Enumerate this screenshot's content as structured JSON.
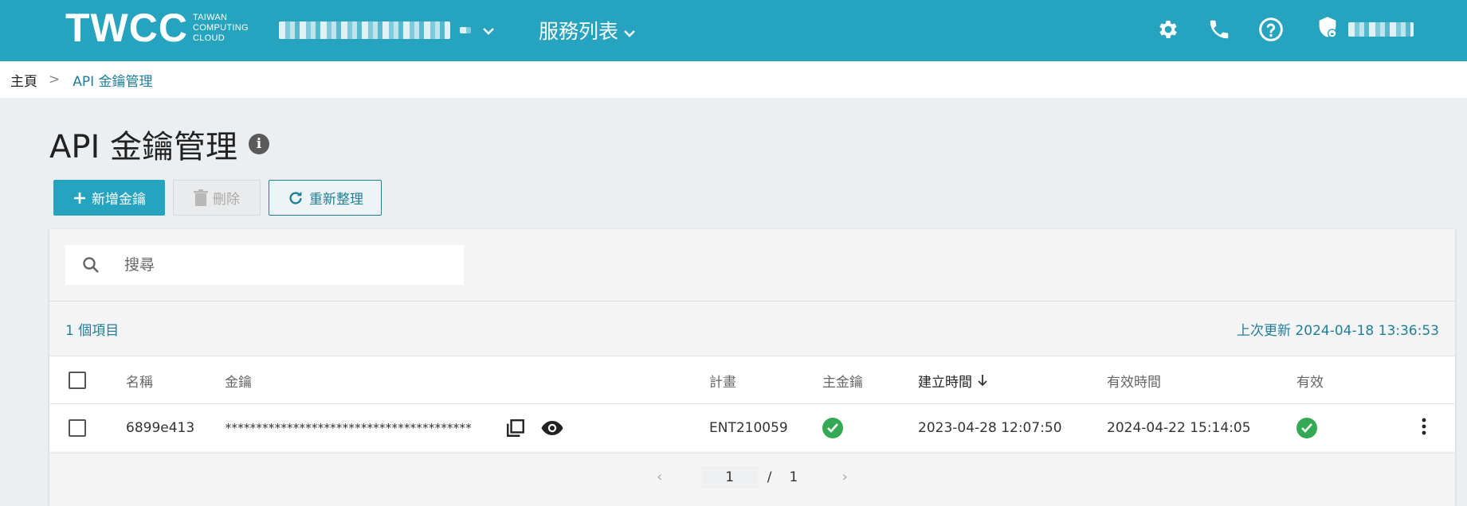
{
  "app": {
    "logo_main": "TWCC",
    "logo_sub": [
      "TAIWAN",
      "COMPUTING",
      "CLOUD"
    ]
  },
  "nav": {
    "services_label": "服務列表",
    "icons": [
      "settings-icon",
      "phone-icon",
      "help-icon",
      "user-shield-icon"
    ]
  },
  "breadcrumb": {
    "home": "主頁",
    "separator": ">",
    "current": "API 金鑰管理"
  },
  "page": {
    "title": "API 金鑰管理"
  },
  "toolbar": {
    "add_label": "新增金鑰",
    "delete_label": "刪除",
    "refresh_label": "重新整理"
  },
  "search": {
    "placeholder": "搜尋"
  },
  "summary": {
    "count_text": "1 個項目",
    "last_updated": "上次更新 2024-04-18 13:36:53"
  },
  "table": {
    "headers": {
      "name": "名稱",
      "key": "金鑰",
      "plan": "計畫",
      "main_key": "主金鑰",
      "created": "建立時間",
      "valid_time": "有效時間",
      "valid": "有效"
    },
    "rows": [
      {
        "name": "6899e413",
        "key": "****************************************",
        "plan": "ENT210059",
        "main_key": true,
        "created": "2023-04-28 12:07:50",
        "valid_time": "2024-04-22 15:14:05",
        "valid": true
      }
    ]
  },
  "pager": {
    "current": "1",
    "separator": "/",
    "total": "1"
  },
  "colors": {
    "brand": "#26a3bf",
    "link": "#1f7f99",
    "success": "#34a853"
  }
}
